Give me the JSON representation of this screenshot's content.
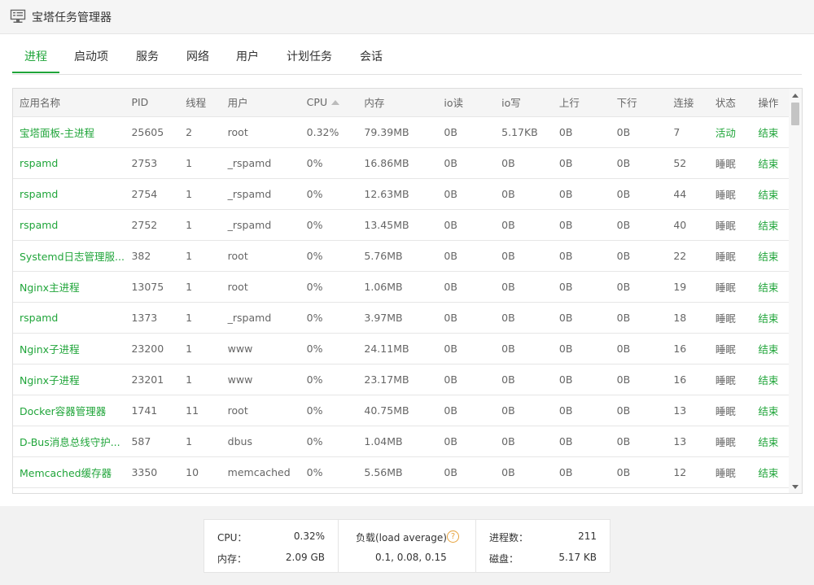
{
  "window": {
    "title": "宝塔任务管理器"
  },
  "tabs": [
    "进程",
    "启动项",
    "服务",
    "网络",
    "用户",
    "计划任务",
    "会话"
  ],
  "table": {
    "columns": [
      "应用名称",
      "PID",
      "线程",
      "用户",
      "CPU",
      "内存",
      "io读",
      "io写",
      "上行",
      "下行",
      "连接",
      "状态",
      "操作"
    ],
    "rows": [
      [
        "宝塔面板-主进程",
        "25605",
        "2",
        "root",
        "0.32%",
        "79.39MB",
        "0B",
        "5.17KB",
        "0B",
        "0B",
        "7",
        "活动",
        "结束"
      ],
      [
        "rspamd",
        "2753",
        "1",
        "_rspamd",
        "0%",
        "16.86MB",
        "0B",
        "0B",
        "0B",
        "0B",
        "52",
        "睡眠",
        "结束"
      ],
      [
        "rspamd",
        "2754",
        "1",
        "_rspamd",
        "0%",
        "12.63MB",
        "0B",
        "0B",
        "0B",
        "0B",
        "44",
        "睡眠",
        "结束"
      ],
      [
        "rspamd",
        "2752",
        "1",
        "_rspamd",
        "0%",
        "13.45MB",
        "0B",
        "0B",
        "0B",
        "0B",
        "40",
        "睡眠",
        "结束"
      ],
      [
        "Systemd日志管理服...",
        "382",
        "1",
        "root",
        "0%",
        "5.76MB",
        "0B",
        "0B",
        "0B",
        "0B",
        "22",
        "睡眠",
        "结束"
      ],
      [
        "Nginx主进程",
        "13075",
        "1",
        "root",
        "0%",
        "1.06MB",
        "0B",
        "0B",
        "0B",
        "0B",
        "19",
        "睡眠",
        "结束"
      ],
      [
        "rspamd",
        "1373",
        "1",
        "_rspamd",
        "0%",
        "3.97MB",
        "0B",
        "0B",
        "0B",
        "0B",
        "18",
        "睡眠",
        "结束"
      ],
      [
        "Nginx子进程",
        "23200",
        "1",
        "www",
        "0%",
        "24.11MB",
        "0B",
        "0B",
        "0B",
        "0B",
        "16",
        "睡眠",
        "结束"
      ],
      [
        "Nginx子进程",
        "23201",
        "1",
        "www",
        "0%",
        "23.17MB",
        "0B",
        "0B",
        "0B",
        "0B",
        "16",
        "睡眠",
        "结束"
      ],
      [
        "Docker容器管理器",
        "1741",
        "11",
        "root",
        "0%",
        "40.75MB",
        "0B",
        "0B",
        "0B",
        "0B",
        "13",
        "睡眠",
        "结束"
      ],
      [
        "D-Bus消息总线守护...",
        "587",
        "1",
        "dbus",
        "0%",
        "1.04MB",
        "0B",
        "0B",
        "0B",
        "0B",
        "13",
        "睡眠",
        "结束"
      ],
      [
        "Memcached缓存器",
        "3350",
        "10",
        "memcached",
        "0%",
        "5.56MB",
        "0B",
        "0B",
        "0B",
        "0B",
        "12",
        "睡眠",
        "结束"
      ]
    ]
  },
  "stats": {
    "cpu_label": "CPU：",
    "cpu_value": "0.32%",
    "mem_label": "内存：",
    "mem_value": "2.09 GB",
    "load_label": "负载(load average)",
    "load_value": "0.1, 0.08, 0.15",
    "proc_label": "进程数：",
    "proc_value": "211",
    "disk_label": "磁盘：",
    "disk_value": "5.17 KB"
  },
  "colors": {
    "accent": "#20a53a",
    "help": "#e6a23c"
  },
  "icons": {
    "window": "monitor-icon",
    "sort": "sort-asc-icon",
    "help": "question-circle-icon"
  }
}
